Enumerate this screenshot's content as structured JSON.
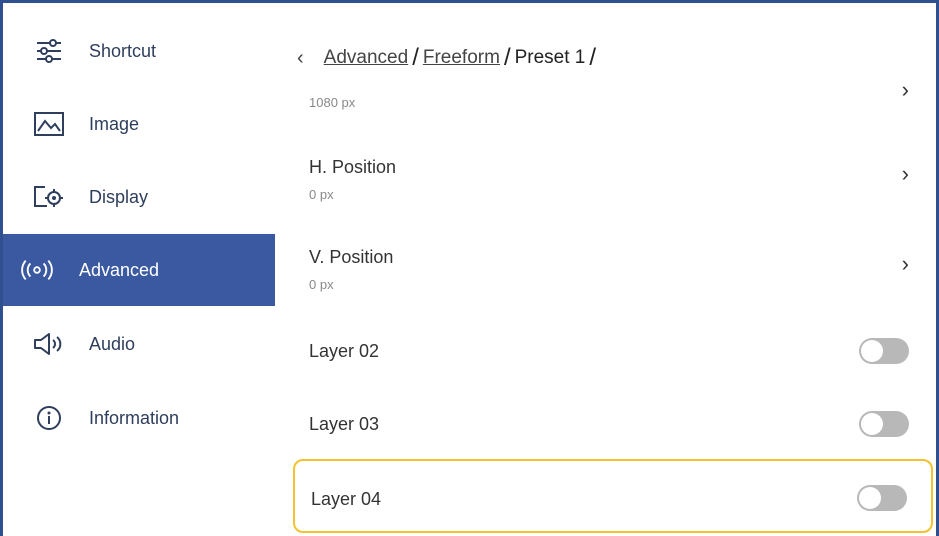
{
  "sidebar": {
    "items": [
      {
        "label": "Shortcut",
        "icon": "sliders-icon"
      },
      {
        "label": "Image",
        "icon": "image-icon"
      },
      {
        "label": "Display",
        "icon": "display-settings-icon"
      },
      {
        "label": "Advanced",
        "icon": "broadcast-icon",
        "active": true
      },
      {
        "label": "Audio",
        "icon": "speaker-icon"
      },
      {
        "label": "Information",
        "icon": "info-icon"
      }
    ]
  },
  "breadcrumb": {
    "items": [
      "Advanced",
      "Freeform"
    ],
    "current": "Preset 1"
  },
  "settings": {
    "partial_value": "1080 px",
    "h_position": {
      "title": "H. Position",
      "value": "0 px"
    },
    "v_position": {
      "title": "V. Position",
      "value": "0 px"
    },
    "layers": [
      {
        "label": "Layer 02",
        "enabled": false
      },
      {
        "label": "Layer 03",
        "enabled": false
      },
      {
        "label": "Layer 04",
        "enabled": false,
        "focused": true
      }
    ]
  },
  "colors": {
    "accent": "#3b59a0",
    "focus_outline": "#f2c230",
    "toggle_off": "#b8b8b8"
  }
}
